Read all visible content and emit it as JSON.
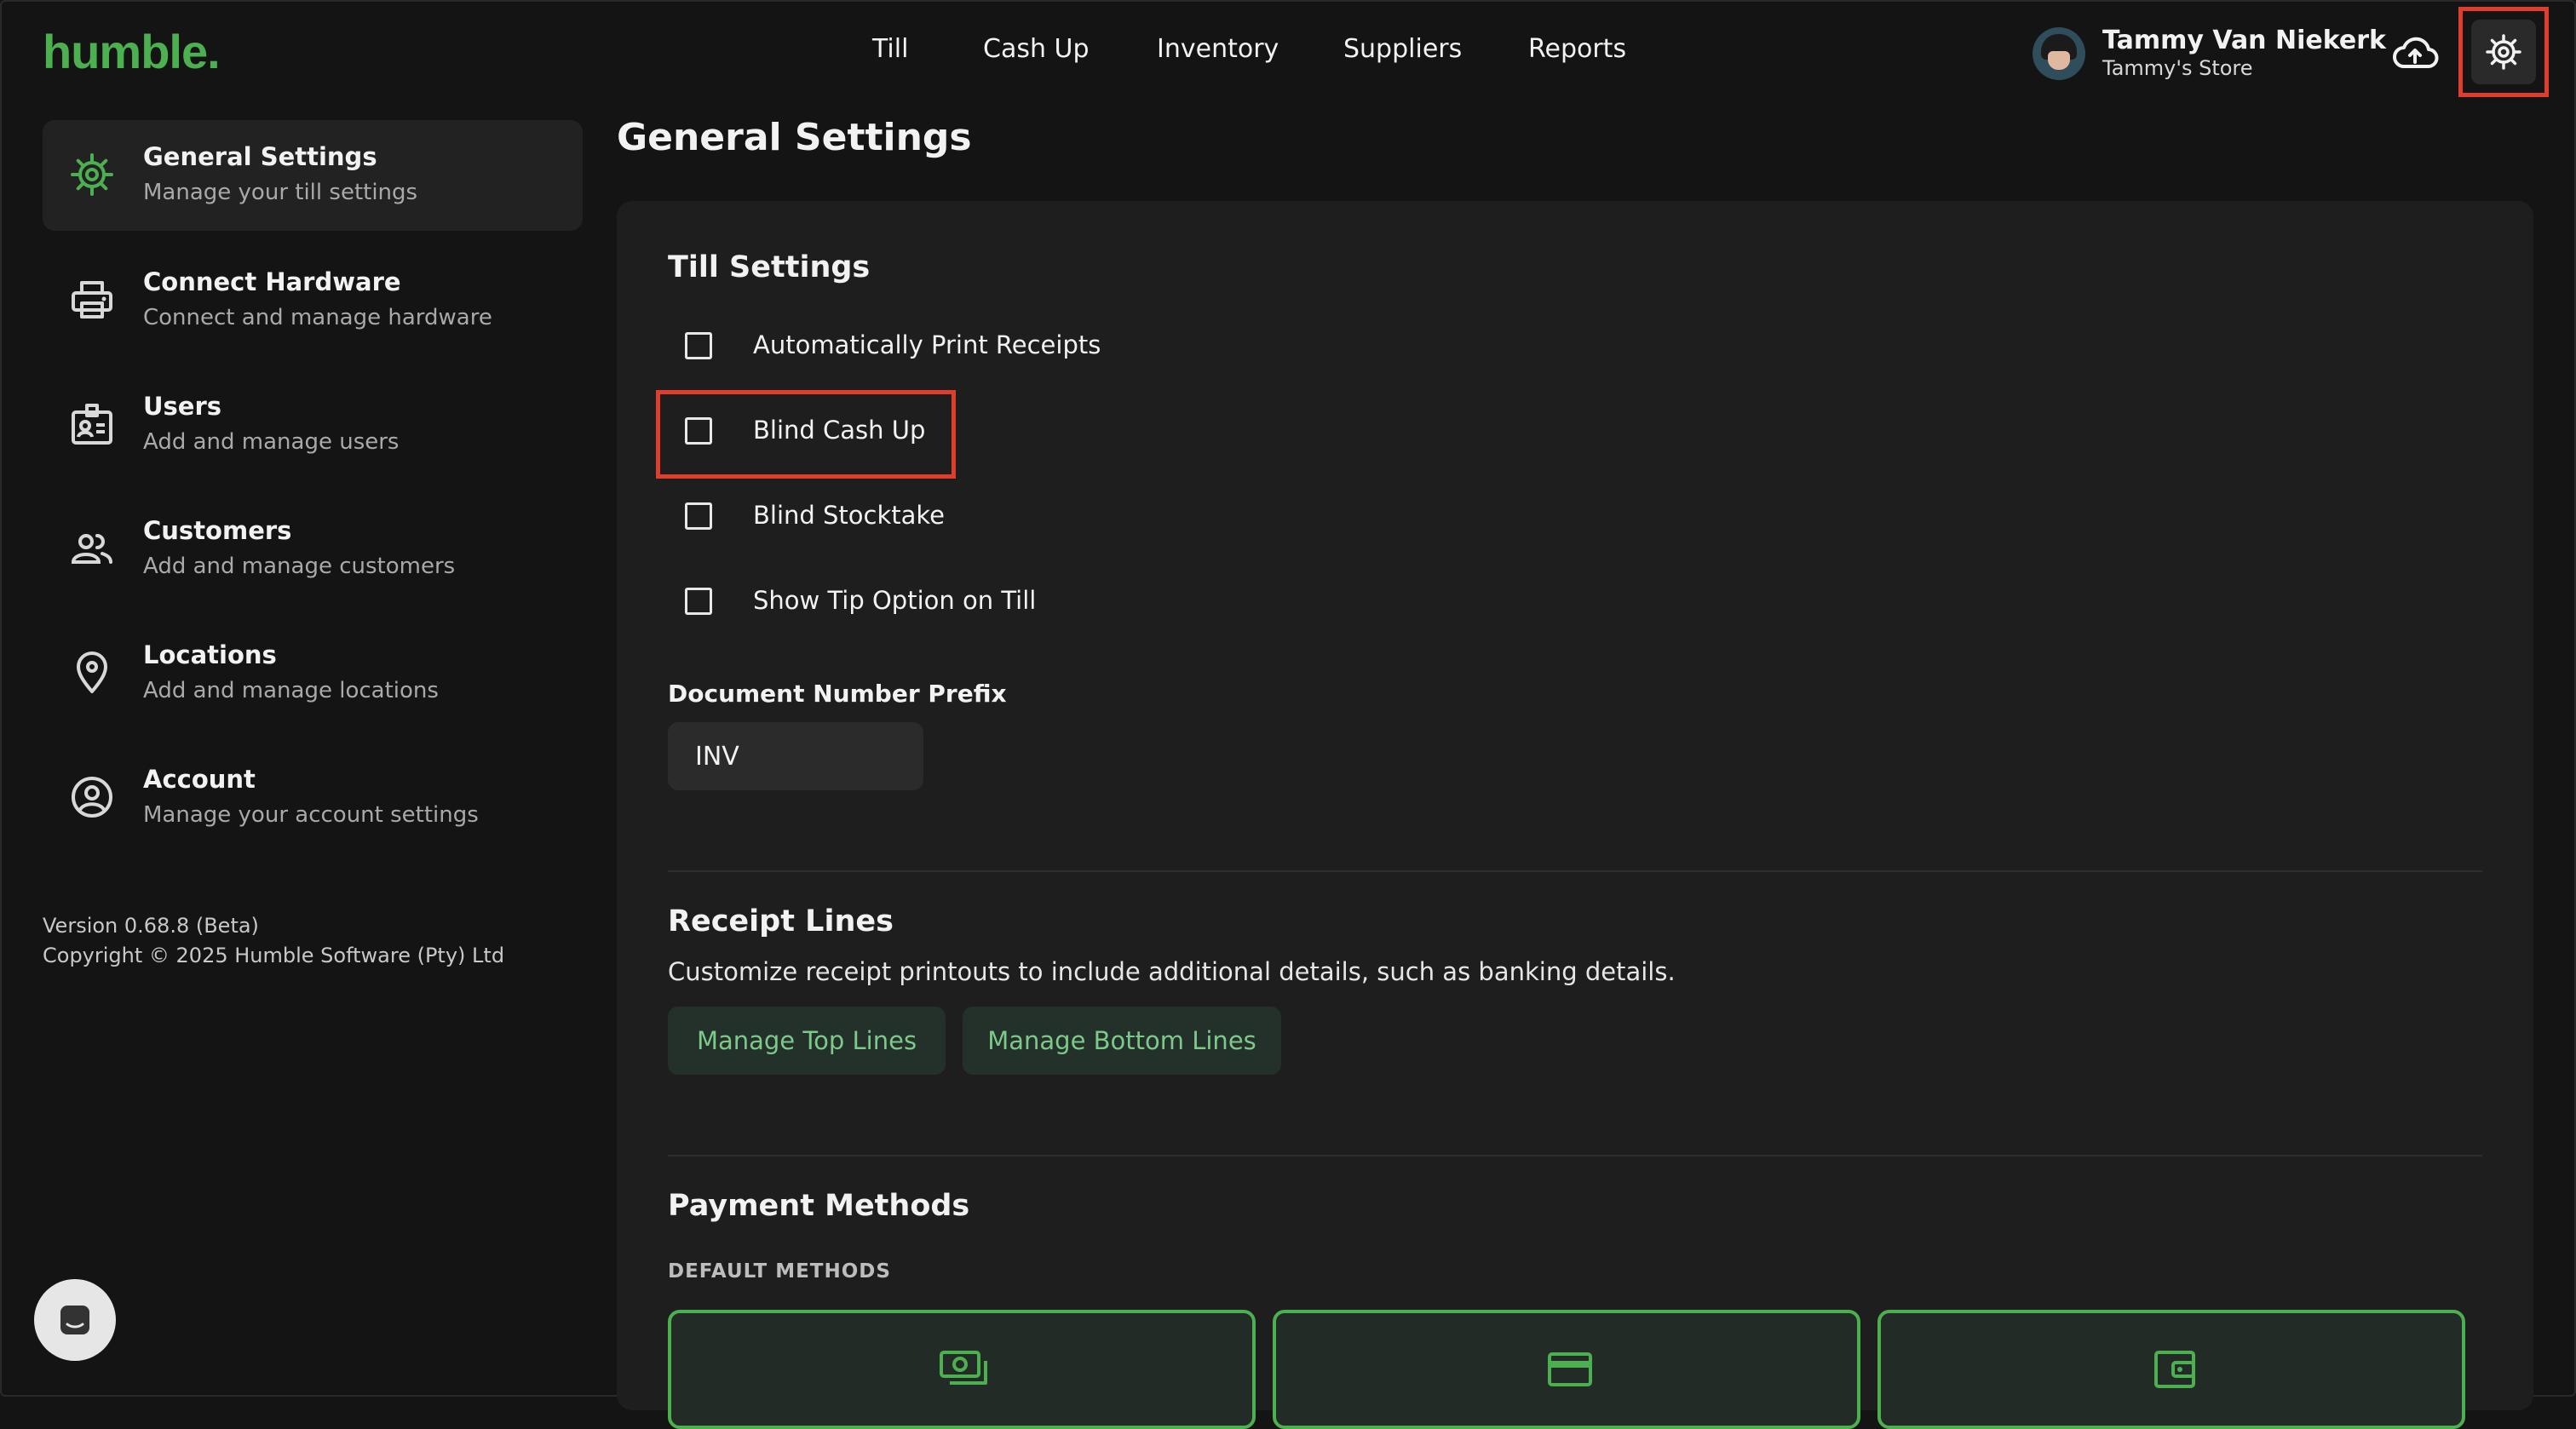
{
  "app": {
    "logo": "humble."
  },
  "nav": {
    "items": [
      "Till",
      "Cash Up",
      "Inventory",
      "Suppliers",
      "Reports"
    ]
  },
  "user": {
    "name": "Tammy Van Niekerk",
    "store": "Tammy's Store"
  },
  "sidebar": {
    "items": [
      {
        "title": "General Settings",
        "subtitle": "Manage your till settings",
        "icon": "gear-icon",
        "active": true
      },
      {
        "title": "Connect Hardware",
        "subtitle": "Connect and manage hardware",
        "icon": "printer-icon"
      },
      {
        "title": "Users",
        "subtitle": "Add and manage users",
        "icon": "badge-icon"
      },
      {
        "title": "Customers",
        "subtitle": "Add and manage customers",
        "icon": "people-icon"
      },
      {
        "title": "Locations",
        "subtitle": "Add and manage locations",
        "icon": "location-pin-icon"
      },
      {
        "title": "Account",
        "subtitle": "Manage your account settings",
        "icon": "account-circle-icon"
      }
    ],
    "version": "Version 0.68.8 (Beta)",
    "copyright": "Copyright © 2025 Humble Software (Pty) Ltd"
  },
  "main": {
    "title": "General Settings",
    "till_settings": {
      "title": "Till Settings",
      "options": [
        {
          "label": "Automatically Print Receipts",
          "checked": false
        },
        {
          "label": "Blind Cash Up",
          "checked": false
        },
        {
          "label": "Blind Stocktake",
          "checked": false
        },
        {
          "label": "Show Tip Option on Till",
          "checked": false
        }
      ],
      "prefix_label": "Document Number Prefix",
      "prefix_value": "INV"
    },
    "receipt_lines": {
      "title": "Receipt Lines",
      "description": "Customize receipt printouts to include additional details, such as banking details.",
      "top_button": "Manage Top Lines",
      "bottom_button": "Manage Bottom Lines"
    },
    "payment_methods": {
      "title": "Payment Methods",
      "caption": "DEFAULT METHODS",
      "cards": [
        "cash-icon",
        "card-icon",
        "wallet-icon"
      ]
    }
  },
  "colors": {
    "background": "#141414",
    "panel": "#1e1e1e",
    "accent_green": "#4caf50",
    "highlight_red": "#e03e2d"
  }
}
